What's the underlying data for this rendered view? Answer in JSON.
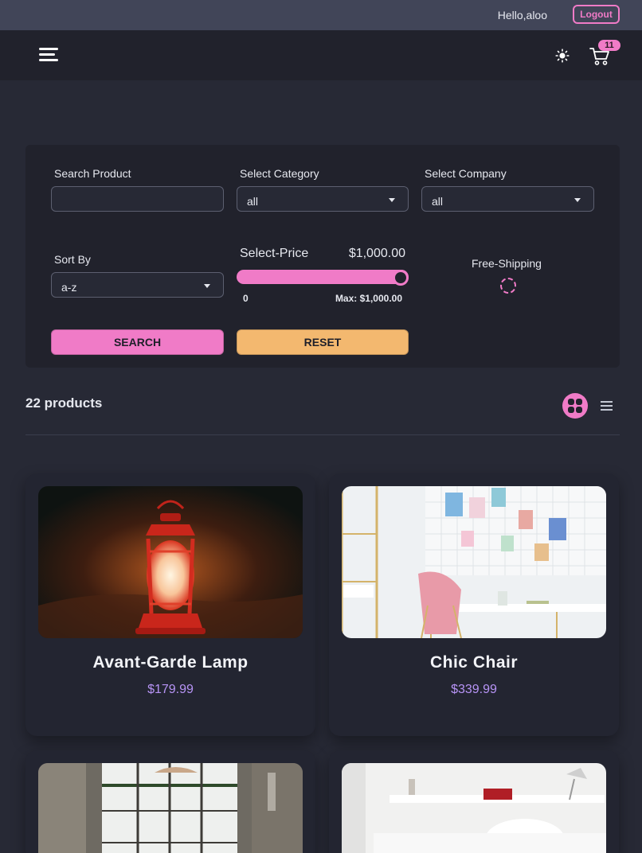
{
  "header": {
    "greeting": "Hello,aloo",
    "logout_label": "Logout"
  },
  "navbar": {
    "menu_icon": "hamburger-menu-icon",
    "theme_icon": "sun-icon",
    "cart_icon": "shopping-cart-icon",
    "cart_count": "11"
  },
  "filters": {
    "search": {
      "label": "Search Product",
      "value": "",
      "placeholder": ""
    },
    "category": {
      "label": "Select Category",
      "value": "all"
    },
    "company": {
      "label": "Select Company",
      "value": "all"
    },
    "sort": {
      "label": "Sort By",
      "value": "a-z"
    },
    "price": {
      "label": "Select-Price",
      "value": "$1,000.00",
      "min": "0",
      "max_label": "Max: $1,000.00",
      "fill_fraction": 1.0
    },
    "shipping": {
      "label": "Free-Shipping",
      "checked": false
    },
    "search_button": "SEARCH",
    "reset_button": "RESET"
  },
  "products_bar": {
    "count_label": "22 products",
    "grid_icon": "grid-view-icon",
    "list_icon": "list-view-icon"
  },
  "products": [
    {
      "title": "Avant-Garde Lamp",
      "price": "$179.99"
    },
    {
      "title": "Chic Chair",
      "price": "$339.99"
    },
    {
      "title": "",
      "price": ""
    },
    {
      "title": "",
      "price": ""
    }
  ],
  "colors": {
    "accent": "#f07bc7",
    "secondary": "#f3b86f",
    "price": "#b794f6",
    "background": "#272935",
    "surface": "#21222c"
  }
}
